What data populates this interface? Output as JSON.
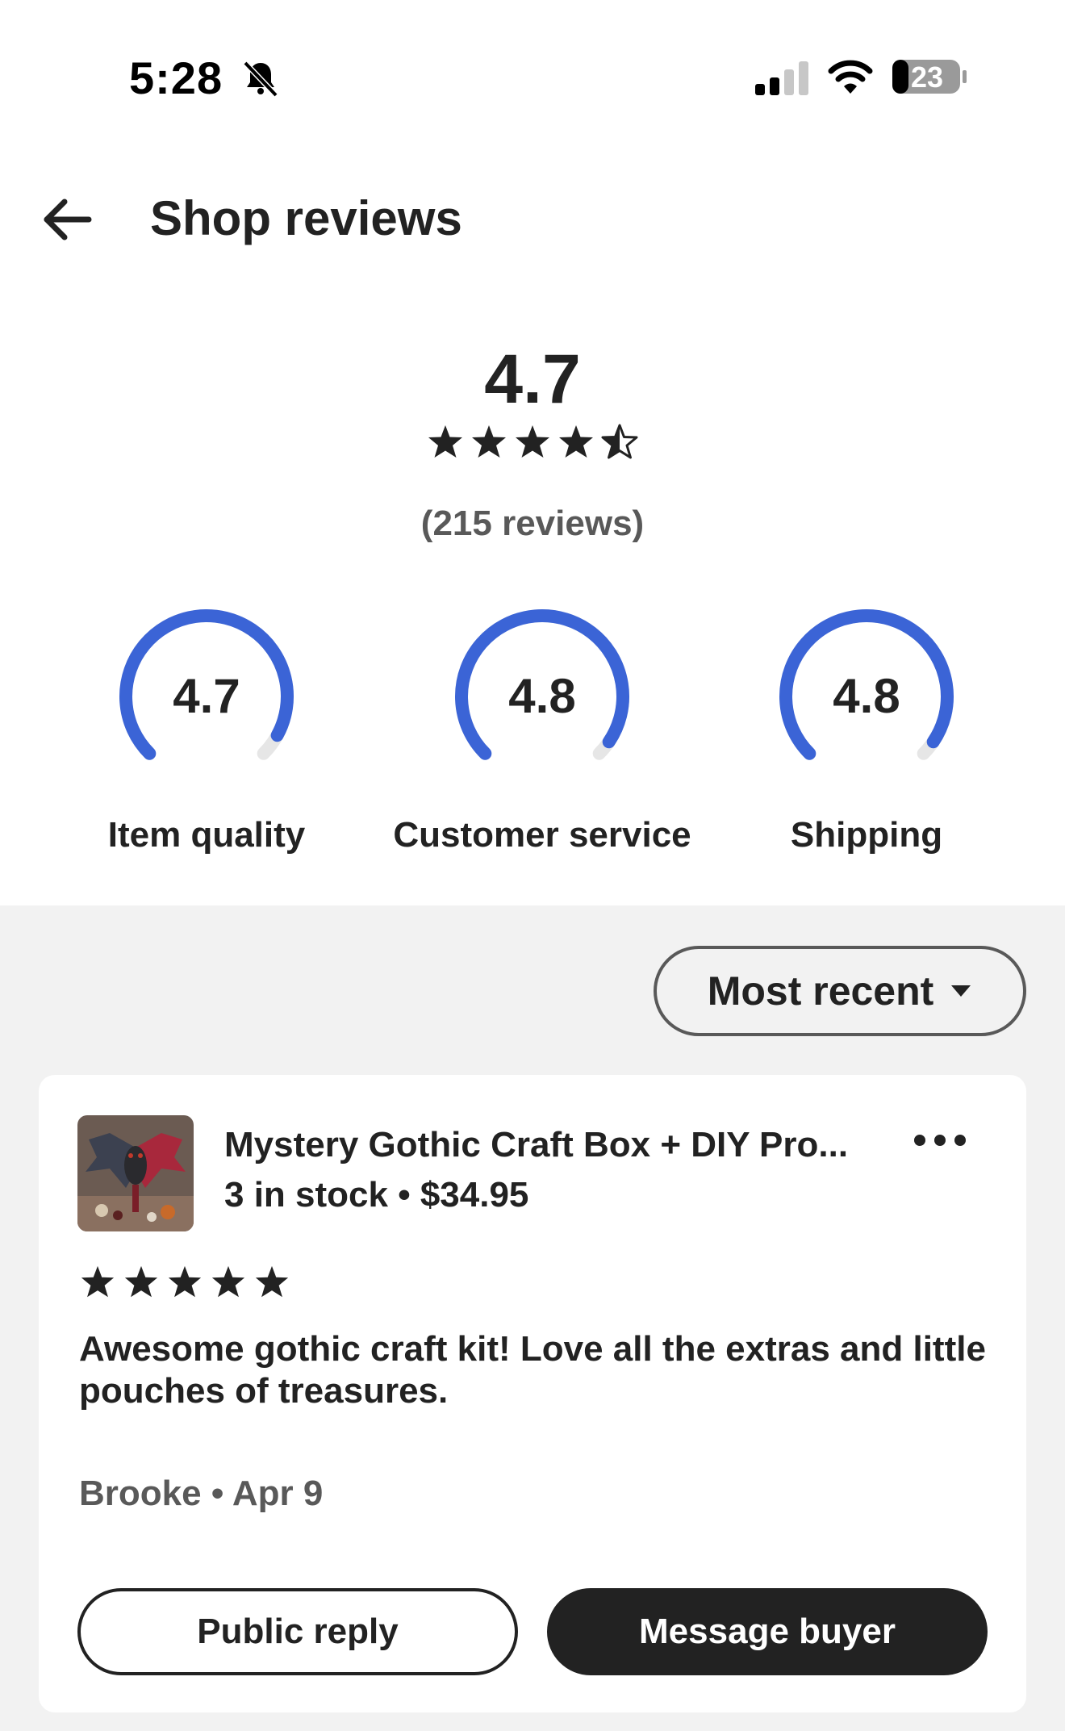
{
  "status_bar": {
    "time": "5:28",
    "battery": "23",
    "icons": [
      "bell-slash-icon",
      "cellular-signal-icon",
      "wifi-icon",
      "battery-icon"
    ]
  },
  "header": {
    "title": "Shop reviews",
    "back_icon": "arrow-left-icon"
  },
  "overall": {
    "score": "4.7",
    "stars": 4.5,
    "count_text": "(215 reviews)"
  },
  "ratings": [
    {
      "value": "4.7",
      "label": "Item quality",
      "fraction": 0.94
    },
    {
      "value": "4.8",
      "label": "Customer service",
      "fraction": 0.96
    },
    {
      "value": "4.8",
      "label": "Shipping",
      "fraction": 0.96
    }
  ],
  "colors": {
    "gauge_fill": "#3b64d6",
    "gauge_track": "#e6e6e6",
    "text": "#222222",
    "muted": "#595959",
    "section_bg": "#f2f2f2"
  },
  "sort": {
    "label": "Most recent",
    "icon": "caret-down-icon"
  },
  "review": {
    "listing_title": "Mystery Gothic Craft Box + DIY Pro...",
    "listing_meta": "3 in stock • $34.95",
    "stars": 5,
    "text": "Awesome gothic craft kit! Love all the extras and little pouches of treasures.",
    "byline": "Brooke • Apr 9",
    "more_icon": "more-horizontal-icon",
    "public_reply_label": "Public reply",
    "message_buyer_label": "Message buyer"
  }
}
